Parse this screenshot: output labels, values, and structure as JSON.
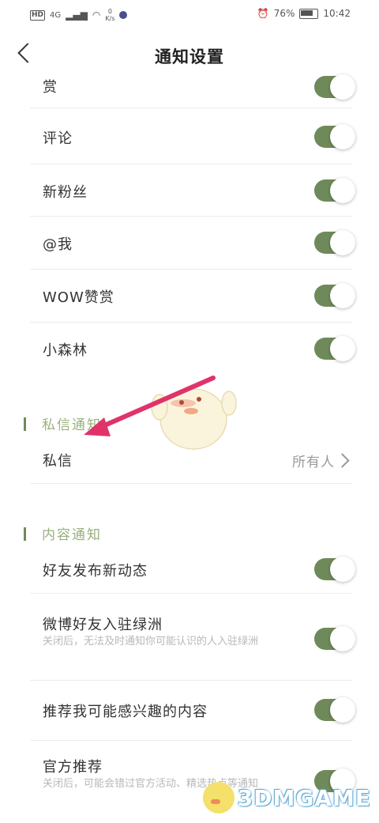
{
  "status_bar": {
    "hd": "HD",
    "signal": "4G",
    "speed_top": "0",
    "speed_bottom": "K/s",
    "battery": "76%",
    "time": "10:42"
  },
  "header": {
    "title": "通知设置"
  },
  "rows_top": [
    {
      "label": "赏",
      "on": true
    },
    {
      "label": "评论",
      "on": true
    },
    {
      "label": "新粉丝",
      "on": true
    },
    {
      "label": "@我",
      "on": true
    },
    {
      "label": "WOW赞赏",
      "on": true
    },
    {
      "label": "小森林",
      "on": true
    }
  ],
  "section_private": {
    "title": "私信通知",
    "row_label": "私信",
    "row_value": "所有人"
  },
  "section_content": {
    "title": "内容通知",
    "rows": [
      {
        "label": "好友发布新动态",
        "desc": "",
        "on": true
      },
      {
        "label": "微博好友入驻绿洲",
        "desc": "关闭后，无法及时通知你可能认识的人入驻绿洲",
        "on": true
      },
      {
        "label": "推荐我可能感兴趣的内容",
        "desc": "",
        "on": true
      },
      {
        "label": "官方推荐",
        "desc": "关闭后，可能会错过官方活动、精选热点等通知",
        "on": true
      }
    ]
  },
  "watermark": {
    "text": "3DMGAME"
  },
  "colors": {
    "toggle_on": "#6f8a5a",
    "section_accent": "#9ab07e",
    "arrow": "#e0336a"
  }
}
